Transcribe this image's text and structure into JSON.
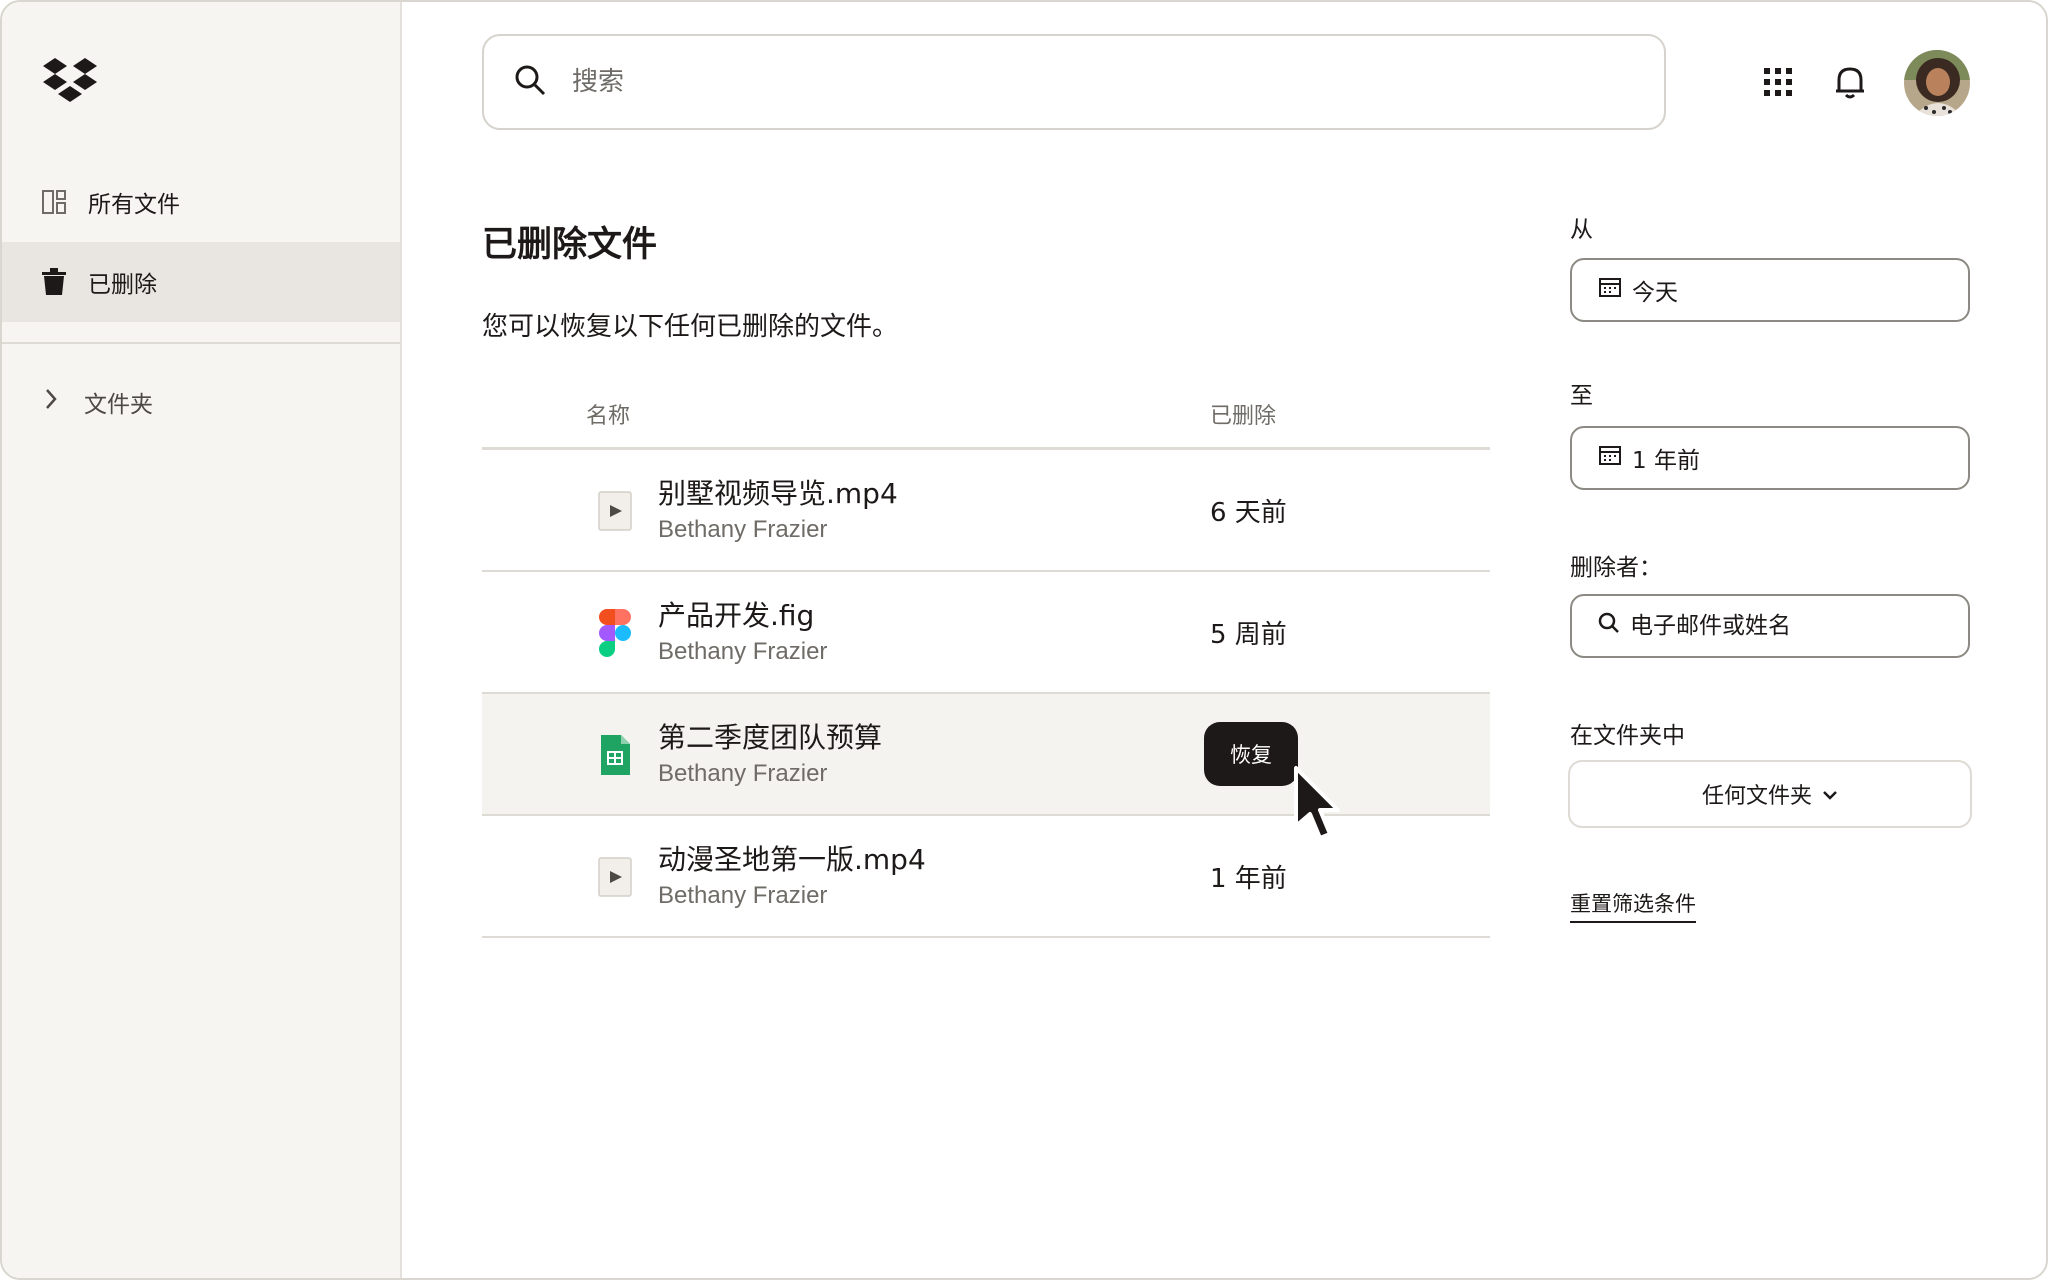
{
  "sidebar": {
    "items": [
      {
        "label": "所有文件",
        "icon": "all-files-icon"
      },
      {
        "label": "已删除",
        "icon": "trash-icon",
        "active": true
      }
    ],
    "folders_label": "文件夹"
  },
  "search": {
    "placeholder": "搜索"
  },
  "header": {
    "icons": [
      "apps-grid-icon",
      "bell-icon",
      "avatar"
    ]
  },
  "main": {
    "title": "已删除文件",
    "description": "您可以恢复以下任何已删除的文件。",
    "columns": {
      "name": "名称",
      "deleted": "已删除"
    },
    "rows": [
      {
        "name": "别墅视频导览.mp4",
        "owner": "Bethany Frazier",
        "deleted": "6 天前",
        "icon": "video-file-icon"
      },
      {
        "name": "产品开发.fig",
        "owner": "Bethany Frazier",
        "deleted": "5 周前",
        "icon": "figma-file-icon"
      },
      {
        "name": "第二季度团队预算",
        "owner": "Bethany Frazier",
        "deleted": "",
        "icon": "spreadsheet-file-icon",
        "hover_action": "恢复"
      },
      {
        "name": "动漫圣地第一版.mp4",
        "owner": "Bethany Frazier",
        "deleted": "1 年前",
        "icon": "video-file-icon"
      }
    ]
  },
  "filters": {
    "from_label": "从",
    "from_value": "今天",
    "to_label": "至",
    "to_value": "1 年前",
    "deleted_by_label": "删除者：",
    "deleted_by_placeholder": "电子邮件或姓名",
    "in_folder_label": "在文件夹中",
    "in_folder_value": "任何文件夹",
    "reset_label": "重置筛选条件"
  },
  "colors": {
    "text": "#1e1919",
    "muted": "#6f6b66",
    "sidebar_bg": "#f7f5f2",
    "active_bg": "#e9e6e1",
    "button_dark": "#1e1919",
    "sheet_green": "#1fa463"
  }
}
